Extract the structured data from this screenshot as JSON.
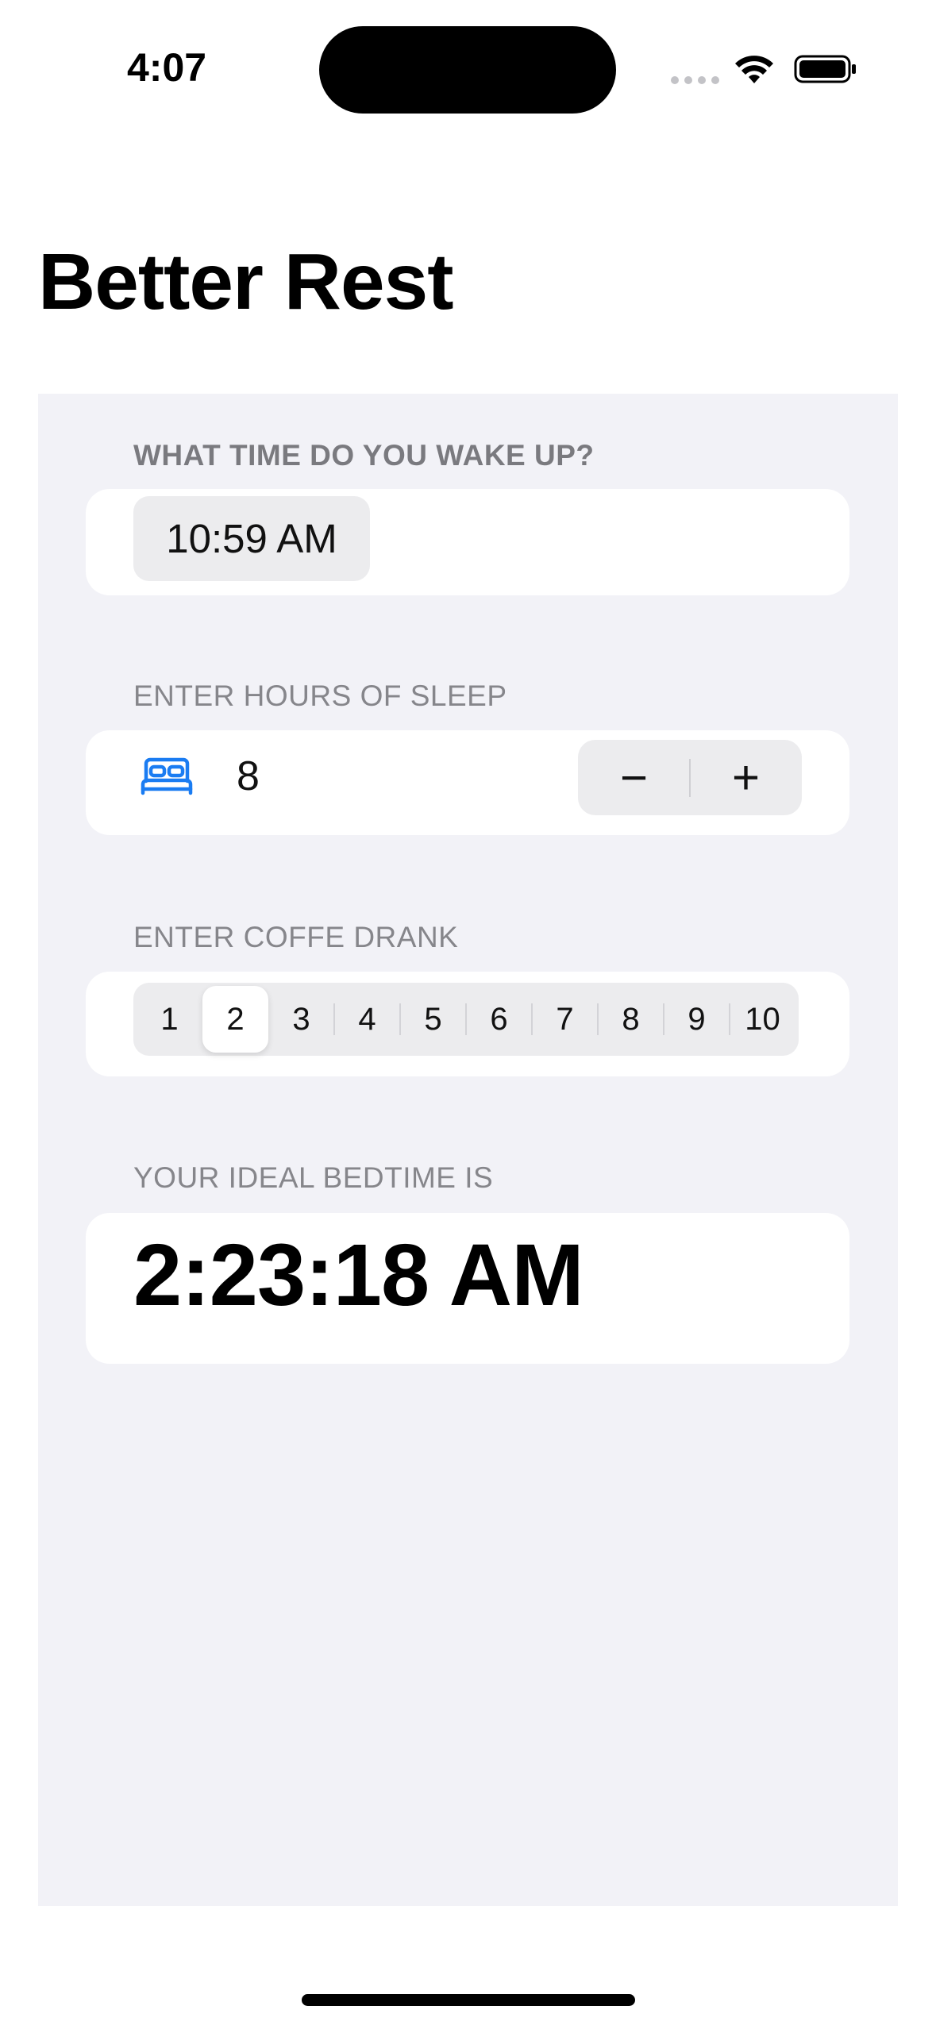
{
  "status_bar": {
    "time": "4:07"
  },
  "title": "Better Rest",
  "wake_section": {
    "header": "WHAT TIME DO YOU WAKE UP?",
    "time_value": "10:59 AM"
  },
  "sleep_section": {
    "header": "ENTER HOURS OF SLEEP",
    "value": "8",
    "icon": "bed-icon",
    "accent_color": "#1a7cf2",
    "decrement_label": "−",
    "increment_label": "+"
  },
  "coffee_section": {
    "header": "ENTER COFFE DRANK",
    "options": [
      "1",
      "2",
      "3",
      "4",
      "5",
      "6",
      "7",
      "8",
      "9",
      "10"
    ],
    "selected": "2"
  },
  "bedtime_section": {
    "header": "YOUR IDEAL BEDTIME IS",
    "value": "2:23:18 AM"
  },
  "colors": {
    "grouped_background": "#f2f2f7",
    "card_background": "#ffffff",
    "header_text": "#86868b"
  }
}
